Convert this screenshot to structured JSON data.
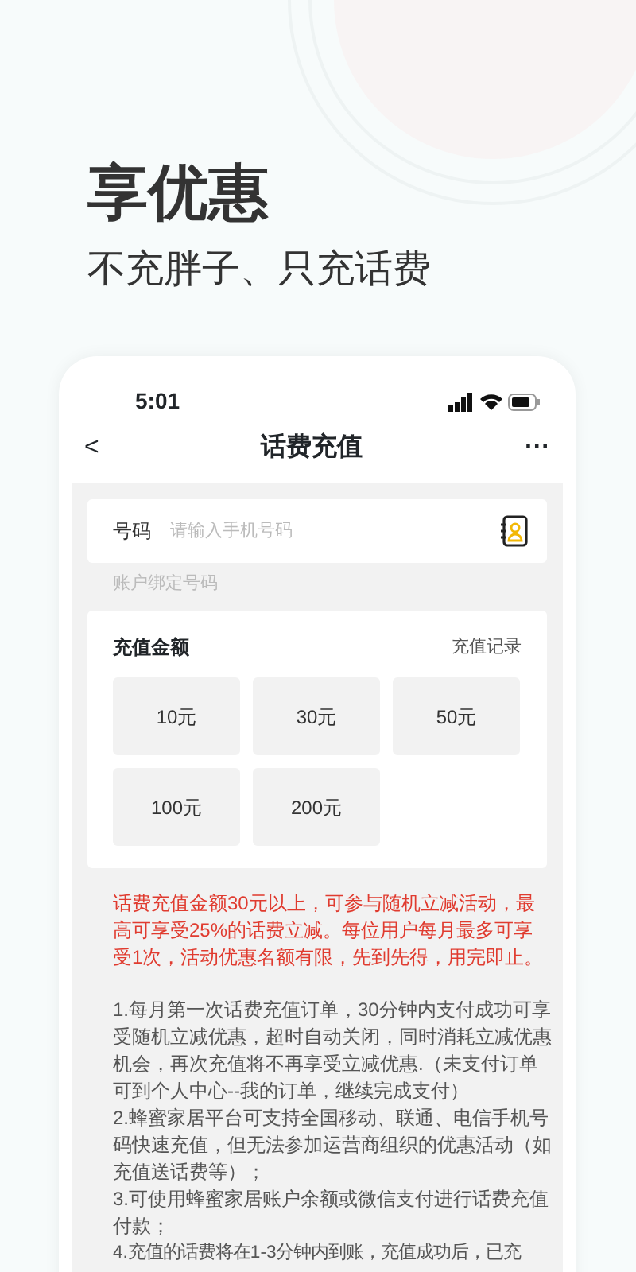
{
  "headline": "享优惠",
  "subheadline": "不充胖子、只充话费",
  "phone": {
    "status_time": "5:01",
    "nav": {
      "back": "<",
      "title": "话费充值",
      "more": "···"
    },
    "number_field": {
      "label": "号码",
      "placeholder": "请输入手机号码"
    },
    "hint": "账户绑定号码",
    "amount_card": {
      "title": "充值金额",
      "link": "充值记录",
      "options": [
        {
          "label": "10元"
        },
        {
          "label": "30元"
        },
        {
          "label": "50元"
        },
        {
          "label": "100元"
        },
        {
          "label": "200元"
        }
      ]
    },
    "promo": "话费充值金额30元以上，可参与随机立减活动，最高可享受25%的话费立减。每位用户每月最多可享受1次，活动优惠名额有限，先到先得，用完即止。",
    "notes": [
      "1.每月第一次话费充值订单，30分钟内支付成功可享受随机立减优惠，超时自动关闭，同时消耗立减优惠机会，再次充值将不再享受立减优惠.（未支付订单可到个人中心--我的订单，继续完成支付）",
      "2.蜂蜜家居平台可支持全国移动、联通、电信手机号码快速充值，但无法参加运营商组织的优惠活动（如充值送话费等）；",
      "3.可使用蜂蜜家居账户余额或微信支付进行话费充值付款；",
      "4.充值的话费将在1-3分钟内到账，充值成功后，已充"
    ]
  }
}
